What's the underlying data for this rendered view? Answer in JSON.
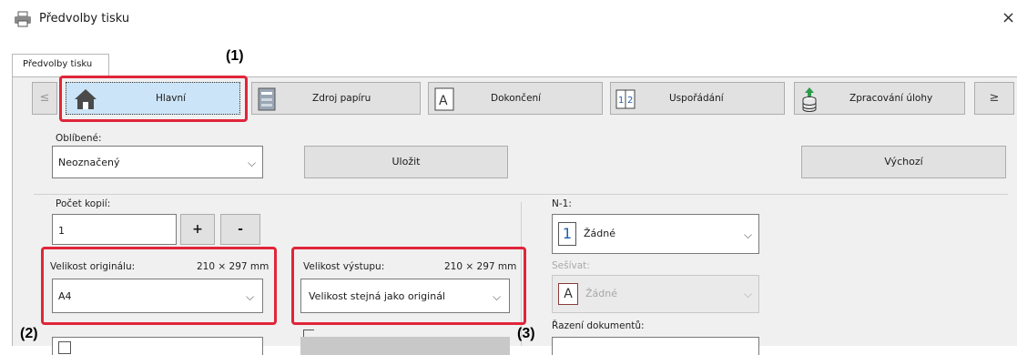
{
  "window": {
    "title": "Předvolby tisku",
    "close_glyph": "×"
  },
  "tab": {
    "label": "Předvolby tisku"
  },
  "nav": {
    "prev_glyph": "≤",
    "next_glyph": "≥",
    "items": [
      {
        "label": "Hlavní",
        "icon": "home-icon"
      },
      {
        "label": "Zdroj papíru",
        "icon": "printer-tray-icon"
      },
      {
        "label": "Dokončení",
        "icon": "finishing-icon"
      },
      {
        "label": "Uspořádání",
        "icon": "layout-icon"
      },
      {
        "label": "Zpracování úlohy",
        "icon": "job-handling-icon"
      }
    ]
  },
  "favorites": {
    "label": "Oblíbené:",
    "value": "Neoznačený",
    "save_label": "Uložit",
    "default_label": "Výchozí"
  },
  "copies": {
    "label": "Počet kopií:",
    "value": "1",
    "plus": "+",
    "minus": "-"
  },
  "original_size": {
    "label": "Velikost originálu:",
    "dims": "210 × 297 mm",
    "value": "A4"
  },
  "output_size": {
    "label": "Velikost výstupu:",
    "dims": "210 × 297 mm",
    "value": "Velikost stejná jako originál"
  },
  "n_up": {
    "label": "N-1:",
    "icon_text": "1",
    "value": "Žádné"
  },
  "staple": {
    "label": "Sešívat:",
    "icon_text": "A",
    "value": "Žádné"
  },
  "document_sort": {
    "label": "Řazení dokumentů:"
  },
  "callouts": {
    "one": "(1)",
    "two": "(2)",
    "three": "(3)"
  },
  "colors": {
    "highlight_red": "#e0253a",
    "selected_tab_blue": "#cce4f7"
  }
}
